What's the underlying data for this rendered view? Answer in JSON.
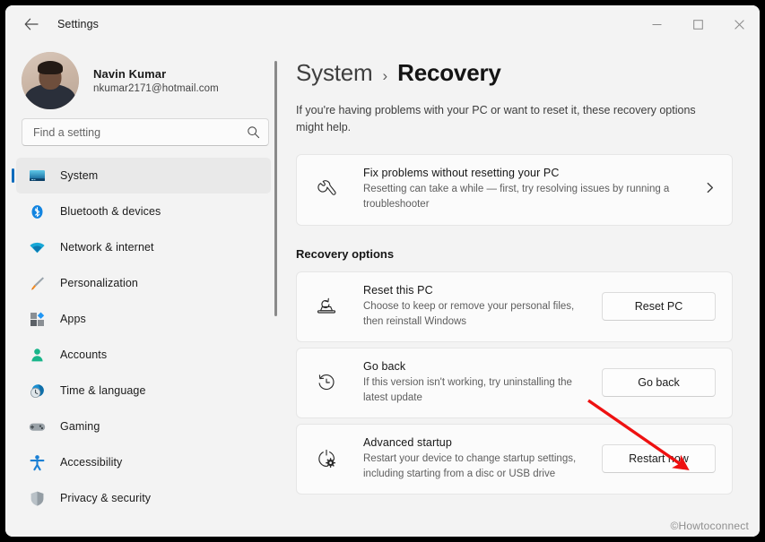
{
  "window": {
    "app_title": "Settings",
    "back_icon": "back-arrow-icon",
    "controls": {
      "minimize": "minimize-icon",
      "maximize": "maximize-icon",
      "close": "close-icon"
    }
  },
  "account": {
    "name": "Navin Kumar",
    "email": "nkumar2171@hotmail.com"
  },
  "search": {
    "placeholder": "Find a setting",
    "value": "",
    "icon": "search-icon"
  },
  "sidebar": {
    "items": [
      {
        "label": "System",
        "icon": "monitor-icon",
        "selected": true
      },
      {
        "label": "Bluetooth & devices",
        "icon": "bluetooth-icon",
        "selected": false
      },
      {
        "label": "Network & internet",
        "icon": "wifi-icon",
        "selected": false
      },
      {
        "label": "Personalization",
        "icon": "paintbrush-icon",
        "selected": false
      },
      {
        "label": "Apps",
        "icon": "apps-icon",
        "selected": false
      },
      {
        "label": "Accounts",
        "icon": "person-icon",
        "selected": false
      },
      {
        "label": "Time & language",
        "icon": "clock-globe-icon",
        "selected": false
      },
      {
        "label": "Gaming",
        "icon": "gamepad-icon",
        "selected": false
      },
      {
        "label": "Accessibility",
        "icon": "accessibility-icon",
        "selected": false
      },
      {
        "label": "Privacy & security",
        "icon": "shield-icon",
        "selected": false
      }
    ]
  },
  "main": {
    "breadcrumb": {
      "parent": "System",
      "separator": "›",
      "current": "Recovery"
    },
    "description": "If you're having problems with your PC or want to reset it, these recovery options might help.",
    "fix_card": {
      "title": "Fix problems without resetting your PC",
      "desc": "Resetting can take a while — first, try resolving issues by running a troubleshooter",
      "icon": "wrench-icon",
      "chevron": "chevron-right-icon"
    },
    "section_title": "Recovery options",
    "options": [
      {
        "title": "Reset this PC",
        "desc": "Choose to keep or remove your personal files, then reinstall Windows",
        "icon": "reset-pc-icon",
        "button": "Reset PC"
      },
      {
        "title": "Go back",
        "desc": "If this version isn't working, try uninstalling the latest update",
        "icon": "history-clock-icon",
        "button": "Go back"
      },
      {
        "title": "Advanced startup",
        "desc": "Restart your device to change startup settings, including starting from a disc or USB drive",
        "icon": "power-gear-icon",
        "button": "Restart now"
      }
    ]
  },
  "annotation": {
    "arrow_color": "#ee1111",
    "arrow_target": "restart-now-button"
  },
  "watermark": "©Howtoconnect",
  "colors": {
    "accent": "#0f6cbd",
    "window_bg": "#f3f3f3",
    "card_bg": "#fbfbfb",
    "selected_bg": "#e9e9e9"
  }
}
